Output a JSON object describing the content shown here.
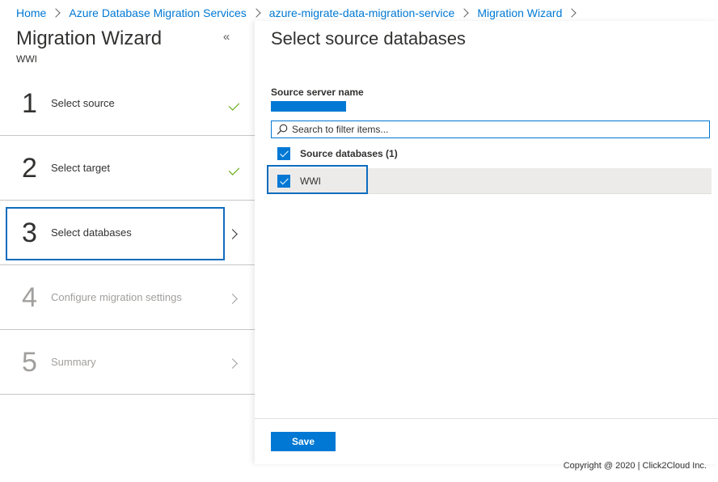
{
  "breadcrumb": {
    "items": [
      {
        "label": "Home"
      },
      {
        "label": "Azure Database Migration Services"
      },
      {
        "label": "azure-migrate-data-migration-service"
      },
      {
        "label": "Migration Wizard"
      }
    ]
  },
  "wizard": {
    "title": "Migration Wizard",
    "subtitle": "WWI",
    "collapse_icon": "double-chevron-left-icon",
    "steps": [
      {
        "number": "1",
        "label": "Select source",
        "status": "completed",
        "icon": "checkmark-icon"
      },
      {
        "number": "2",
        "label": "Select target",
        "status": "completed",
        "icon": "checkmark-icon"
      },
      {
        "number": "3",
        "label": "Select databases",
        "status": "current",
        "icon": "chevron-right-icon"
      },
      {
        "number": "4",
        "label": "Configure migration settings",
        "status": "disabled",
        "icon": "chevron-right-icon"
      },
      {
        "number": "5",
        "label": "Summary",
        "status": "disabled",
        "icon": "chevron-right-icon"
      }
    ]
  },
  "content": {
    "title": "Select source databases",
    "source_server_label": "Source server name",
    "search": {
      "placeholder": "Search to filter items...",
      "value": ""
    },
    "select_all": {
      "label": "Source databases (1)",
      "checked": true
    },
    "databases": [
      {
        "name": "WWI",
        "checked": true
      }
    ],
    "save_label": "Save"
  },
  "footer": {
    "copyright": "Copyright @ 2020 |   Click2Cloud Inc."
  },
  "colors": {
    "accent": "#0078d4",
    "success": "#57a300",
    "highlight_border": "#0f6cbd",
    "disabled_text": "#a19f9d"
  }
}
